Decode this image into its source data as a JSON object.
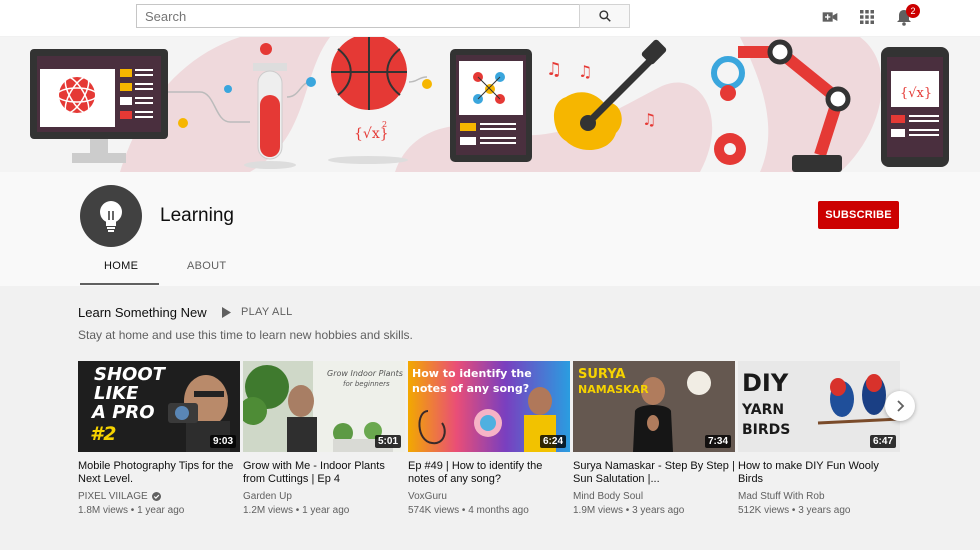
{
  "search": {
    "placeholder": "Search",
    "value": ""
  },
  "header_icons": [
    "search-icon",
    "create-video-icon",
    "apps-icon",
    "notifications-icon"
  ],
  "notifications": {
    "count": "2"
  },
  "channel": {
    "name": "Learning",
    "subscribe_label": "SUBSCRIBE"
  },
  "tabs": [
    {
      "label": "HOME",
      "active": true
    },
    {
      "label": "ABOUT",
      "active": false
    }
  ],
  "section": {
    "title": "Learn Something New",
    "play_all": "PLAY ALL",
    "description": "Stay at home and use this time to learn new hobbies and skills."
  },
  "videos": [
    {
      "title": "Mobile Photography Tips for the Next Level.",
      "channel": "PIXEL VIILAGE",
      "verified": true,
      "views": "1.8M views",
      "age": "1 year ago",
      "duration": "9:03",
      "thumb_text": [
        "SHOOT",
        "LIKE",
        "A PRO",
        "#2"
      ]
    },
    {
      "title": "Grow with Me - Indoor Plants from Cuttings | Ep 4",
      "channel": "Garden Up",
      "verified": false,
      "views": "1.2M views",
      "age": "1 year ago",
      "duration": "5:01",
      "thumb_text": [
        "Grow Indoor Plants",
        "for beginners"
      ]
    },
    {
      "title": "Ep #49 | How to identify the notes of any song?",
      "channel": "VoxGuru",
      "verified": false,
      "views": "574K views",
      "age": "4 months ago",
      "duration": "6:24",
      "thumb_text": [
        "How to identify the",
        "notes of any song?"
      ]
    },
    {
      "title": "Surya Namaskar - Step By Step | Sun Salutation |...",
      "channel": "Mind Body Soul",
      "verified": false,
      "views": "1.9M views",
      "age": "3 years ago",
      "duration": "7:34",
      "thumb_text": [
        "SURYA",
        "NAMASKAR"
      ]
    },
    {
      "title": "How to make DIY Fun Wooly Birds",
      "channel": "Mad Stuff With Rob",
      "verified": false,
      "views": "512K views",
      "age": "3 years ago",
      "duration": "6:47",
      "thumb_text": [
        "DIY",
        "YARN",
        "BIRDS"
      ]
    }
  ],
  "colors": {
    "brand_red": "#cc0000",
    "banner_pink": "#efd9dc",
    "banner_red": "#e53935"
  }
}
